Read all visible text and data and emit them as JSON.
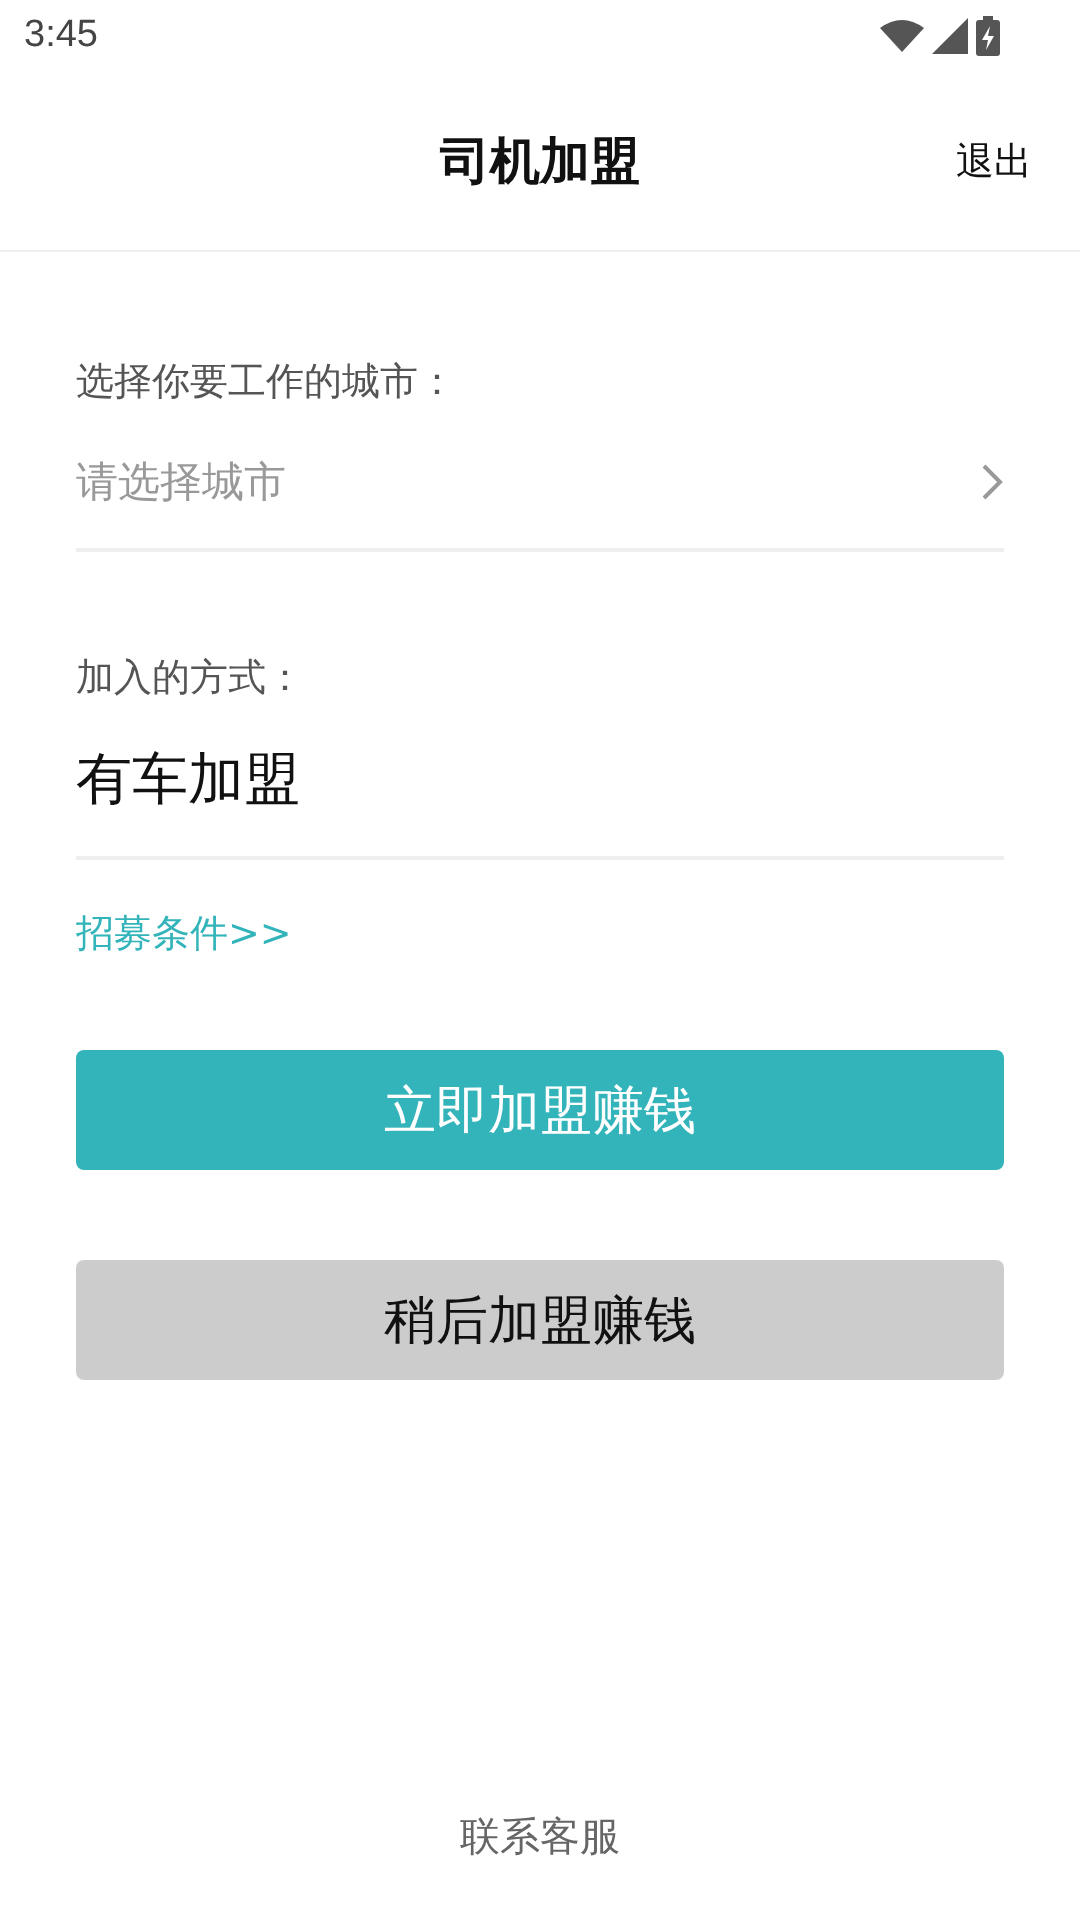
{
  "status_bar": {
    "time": "3:45"
  },
  "header": {
    "title": "司机加盟",
    "action": "退出"
  },
  "city": {
    "label": "选择你要工作的城市：",
    "placeholder": "请选择城市"
  },
  "mode": {
    "label": "加入的方式：",
    "value": "有车加盟"
  },
  "link": "招募条件>>",
  "buttons": [
    {
      "label": "立即加盟赚钱",
      "kind": "primary"
    },
    {
      "label": "稍后加盟赚钱",
      "kind": "secondary"
    }
  ],
  "footer": "联系客服"
}
